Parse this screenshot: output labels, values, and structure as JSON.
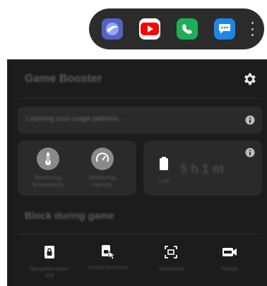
{
  "pinned_apps": [
    {
      "name": "samsung-internet-icon",
      "color": "#5363c7"
    },
    {
      "name": "youtube-icon",
      "color": "#ff0000"
    },
    {
      "name": "phone-icon",
      "color": "#1fae57"
    },
    {
      "name": "messages-icon",
      "color": "#1f86e8"
    }
  ],
  "game_booster": {
    "title": "Game Booster",
    "learning_text": "Learning your usage patterns...",
    "stats": {
      "temperature_label": "Monitoring temperature",
      "memory_label": "Monitoring memory",
      "battery_label": "Left",
      "battery_time": "5 h 1 m"
    },
    "block_title": "Block during game",
    "tools": [
      {
        "icon": "lock-icon",
        "label": "Navigation button lock"
      },
      {
        "icon": "touch-lock-icon",
        "label": "Screen touch lock"
      },
      {
        "icon": "screenshot-icon",
        "label": "Screenshot"
      },
      {
        "icon": "record-icon",
        "label": "Record"
      }
    ]
  }
}
